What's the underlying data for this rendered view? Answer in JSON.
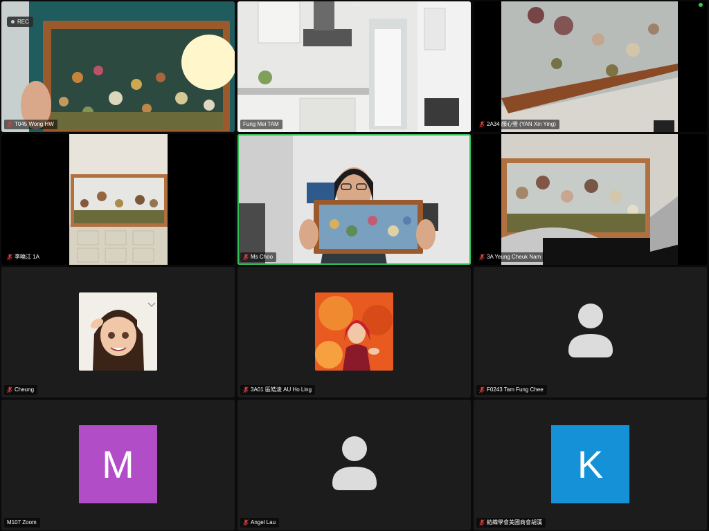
{
  "recording": {
    "label": "REC"
  },
  "colors": {
    "avatar_m": "#b24dc8",
    "avatar_k": "#1591d8",
    "active_speaker": "#33c25a",
    "mic_muted": "#e23b3b"
  },
  "participants": [
    {
      "name": "T045 Wong HW",
      "muted": true,
      "video": "frame-hand"
    },
    {
      "name": "Fung Mei TAM",
      "muted": false,
      "video": "kitchen"
    },
    {
      "name": "2A34 顏心瑩 (YAN Xin Ying)",
      "muted": true,
      "video": "frame-closeup"
    },
    {
      "name": "李曉江 1A",
      "muted": true,
      "video": "frame-table"
    },
    {
      "name": "Ms Choo",
      "muted": true,
      "video": "teacher"
    },
    {
      "name": "3A Yeung Cheuk Nam",
      "muted": true,
      "video": "frame-wall"
    },
    {
      "name": "Cheung",
      "muted": true,
      "video": "cartoon-girl"
    },
    {
      "name": "3A01 區皓淩 AU Ho Ling",
      "muted": true,
      "video": "anime"
    },
    {
      "name": "F0243 Tam Fung Chee",
      "muted": true,
      "video": "person-icon"
    },
    {
      "name": "M107 Zoom",
      "muted": false,
      "video": "letter",
      "letter": "M"
    },
    {
      "name": "Angel Lau",
      "muted": true,
      "video": "person-icon"
    },
    {
      "name": "紡織學會美國商會胡漢",
      "muted": true,
      "video": "letter",
      "letter": "K"
    }
  ]
}
